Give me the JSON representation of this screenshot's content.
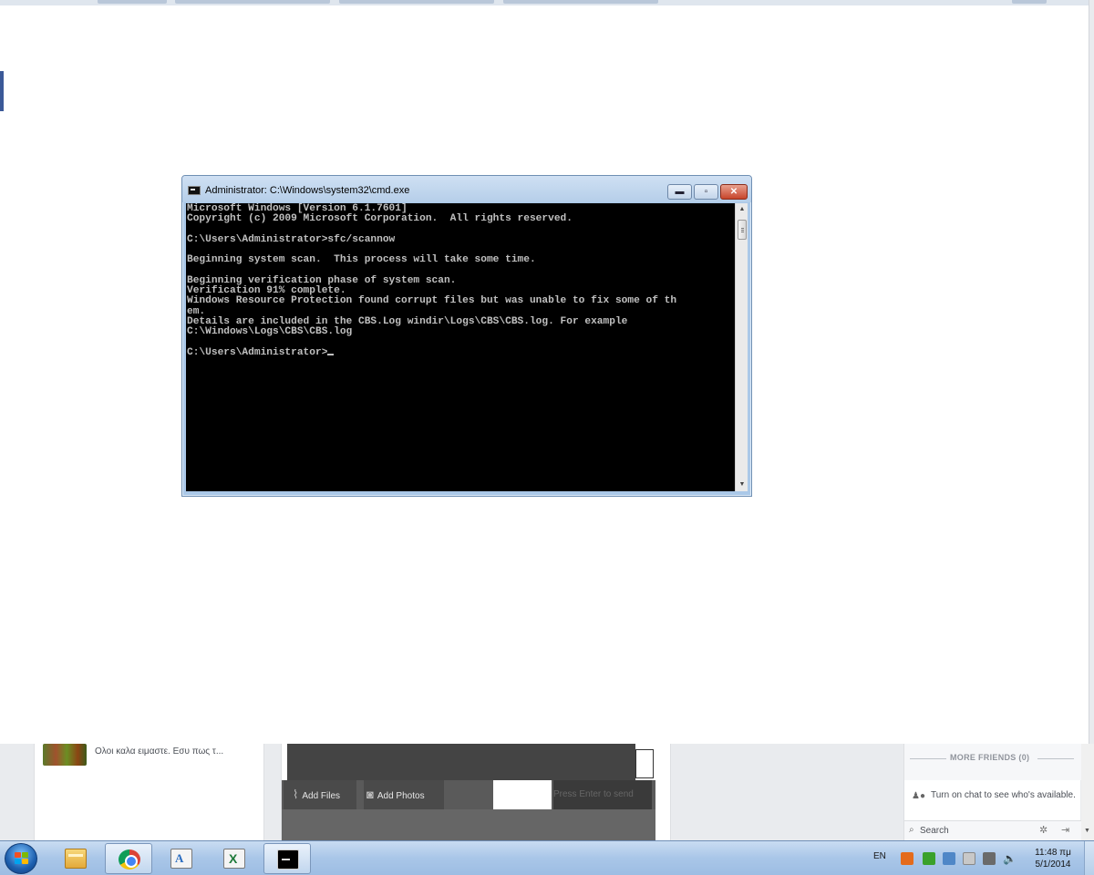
{
  "cmd_window": {
    "title": "Administrator: C:\\Windows\\system32\\cmd.exe",
    "buttons": {
      "minimize": "▬",
      "maximize": "▫",
      "close": "✕"
    },
    "console_lines": [
      "Microsoft Windows [Version 6.1.7601]",
      "Copyright (c) 2009 Microsoft Corporation.  All rights reserved.",
      "",
      "C:\\Users\\Administrator>sfc/scannow",
      "",
      "Beginning system scan.  This process will take some time.",
      "",
      "Beginning verification phase of system scan.",
      "Verification 91% complete.",
      "Windows Resource Protection found corrupt files but was unable to fix some of th",
      "em.",
      "Details are included in the CBS.Log windir\\Logs\\CBS\\CBS.log. For example",
      "C:\\Windows\\Logs\\CBS\\CBS.log",
      "",
      "C:\\Users\\Administrator>"
    ],
    "scroll_up_arrow": "▲",
    "scroll_down_arrow": "▼"
  },
  "facebook": {
    "message_snippet": "Ολοι καλα ειμαστε. Εσυ πως τ...",
    "chat": {
      "add_files": "Add Files",
      "add_photos": "Add Photos",
      "send_hint": "Press Enter to send"
    },
    "sidebar": {
      "more_friends": "MORE FRIENDS (0)",
      "chat_status": "Turn on chat to see who's available.",
      "search": "Search"
    }
  },
  "taskbar": {
    "language": "EN",
    "time": "11:48 πμ",
    "date": "5/1/2014",
    "pinned": [
      {
        "icon": "explorer-icon"
      },
      {
        "icon": "chrome-icon"
      },
      {
        "icon": "access-icon"
      },
      {
        "icon": "excel-icon"
      },
      {
        "icon": "cmd-icon"
      }
    ]
  },
  "colors": {
    "console_bg": "#000000",
    "console_text": "#c0c0c0",
    "title_bar": "#b5cee9",
    "close_button": "#c7452b",
    "taskbar": "#a9c6e8"
  }
}
